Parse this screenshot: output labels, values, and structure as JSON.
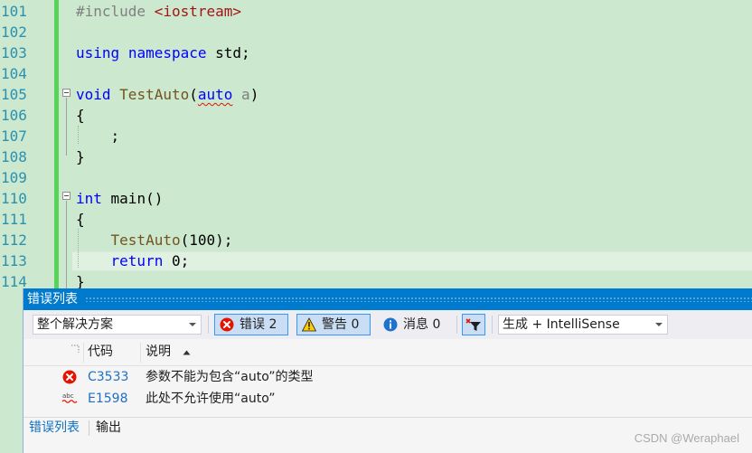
{
  "editor": {
    "lines": [
      {
        "num": "101",
        "tokens": [
          {
            "t": "#include ",
            "c": "pp"
          },
          {
            "t": "<iostream>",
            "c": "str"
          }
        ]
      },
      {
        "num": "102",
        "tokens": []
      },
      {
        "num": "103",
        "tokens": [
          {
            "t": "using",
            "c": "kw"
          },
          {
            "t": " "
          },
          {
            "t": "namespace",
            "c": "kw"
          },
          {
            "t": " std;"
          }
        ]
      },
      {
        "num": "104",
        "tokens": []
      },
      {
        "num": "105",
        "tokens": [
          {
            "t": "void",
            "c": "kw"
          },
          {
            "t": " "
          },
          {
            "t": "TestAuto",
            "c": "fn"
          },
          {
            "t": "("
          },
          {
            "t": "auto",
            "c": "kw squig"
          },
          {
            "t": " "
          },
          {
            "t": "a",
            "c": "param"
          },
          {
            "t": ")"
          }
        ]
      },
      {
        "num": "106",
        "tokens": [
          {
            "t": "{"
          }
        ]
      },
      {
        "num": "107",
        "tokens": [
          {
            "t": "    ;"
          }
        ]
      },
      {
        "num": "108",
        "tokens": [
          {
            "t": "}"
          }
        ]
      },
      {
        "num": "109",
        "tokens": []
      },
      {
        "num": "110",
        "tokens": [
          {
            "t": "int",
            "c": "kw"
          },
          {
            "t": " main()"
          }
        ]
      },
      {
        "num": "111",
        "tokens": [
          {
            "t": "{"
          }
        ]
      },
      {
        "num": "112",
        "tokens": [
          {
            "t": "    "
          },
          {
            "t": "TestAuto",
            "c": "fn"
          },
          {
            "t": "(100);"
          }
        ]
      },
      {
        "num": "113",
        "tokens": [
          {
            "t": "    "
          },
          {
            "t": "return",
            "c": "kw"
          },
          {
            "t": " 0;"
          }
        ]
      },
      {
        "num": "114",
        "tokens": [
          {
            "t": "}"
          }
        ]
      }
    ]
  },
  "error_list": {
    "title": "错误列表",
    "scope": "整个解决方案",
    "errors_label": "错误 2",
    "warnings_label": "警告 0",
    "messages_label": "消息 0",
    "build_filter": "生成 + IntelliSense",
    "col_code": "代码",
    "col_desc": "说明",
    "rows": [
      {
        "code": "C3533",
        "desc": "参数不能为包含“auto”的类型",
        "icon": "error-icon"
      },
      {
        "code": "E1598",
        "desc": "此处不允许使用“auto”",
        "icon": "intellisense-abc-icon"
      }
    ],
    "tabs": [
      "错误列表",
      "输出"
    ]
  },
  "watermark": "CSDN @Weraphael",
  "colors": {
    "editor_bg": "#cce8cf",
    "titlebar": "#007acc",
    "keyword": "#0000ff",
    "line_number": "#2b91af",
    "error_red": "#e51400"
  }
}
